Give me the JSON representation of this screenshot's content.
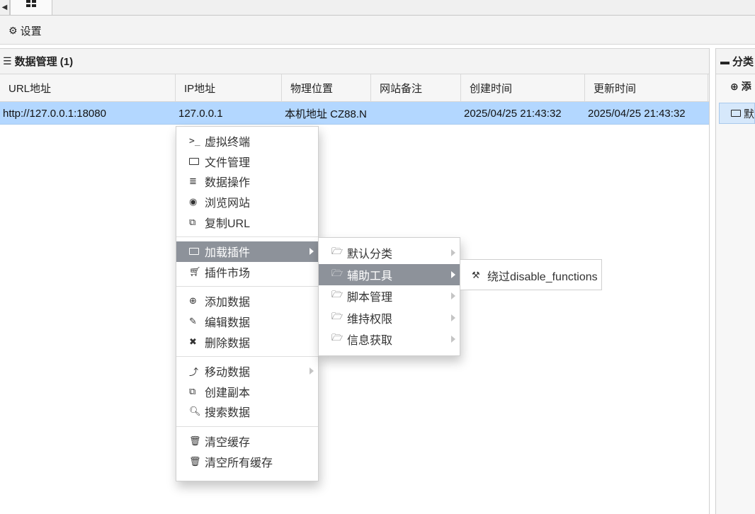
{
  "toolbar": {
    "settings_label": "设置"
  },
  "data_panel": {
    "title": "数据管理 (1)",
    "columns": [
      "URL地址",
      "IP地址",
      "物理位置",
      "网站备注",
      "创建时间",
      "更新时间"
    ],
    "rows": [
      {
        "url": "http://127.0.0.1:18080",
        "ip": "127.0.0.1",
        "location": "本机地址 CZ88.N",
        "note": "",
        "created": "2025/04/25 21:43:32",
        "updated": "2025/04/25 21:43:32"
      }
    ]
  },
  "category_panel": {
    "title": "分类",
    "add_label": "添",
    "selected_item": "默"
  },
  "context_menu": {
    "groups": [
      [
        {
          "label": "虚拟终端",
          "icon": "terminal-icon"
        },
        {
          "label": "文件管理",
          "icon": "folder-icon"
        },
        {
          "label": "数据操作",
          "icon": "database-icon"
        },
        {
          "label": "浏览网站",
          "icon": "chrome-icon"
        },
        {
          "label": "复制URL",
          "icon": "copy-icon"
        }
      ],
      [
        {
          "label": "加载插件",
          "icon": "folder-icon",
          "submenu": true,
          "active": true
        },
        {
          "label": "插件市场",
          "icon": "cart-icon"
        }
      ],
      [
        {
          "label": "添加数据",
          "icon": "plus-circle-icon"
        },
        {
          "label": "编辑数据",
          "icon": "edit-icon"
        },
        {
          "label": "删除数据",
          "icon": "close-icon"
        }
      ],
      [
        {
          "label": "移动数据",
          "icon": "share-icon",
          "submenu": true
        },
        {
          "label": "创建副本",
          "icon": "copy-icon"
        },
        {
          "label": "搜索数据",
          "icon": "search-icon"
        }
      ],
      [
        {
          "label": "清空缓存",
          "icon": "trash-outline-icon"
        },
        {
          "label": "清空所有缓存",
          "icon": "trash-icon"
        }
      ]
    ]
  },
  "plugin_submenu": {
    "items": [
      {
        "label": "默认分类",
        "icon": "folder-open-icon"
      },
      {
        "label": "辅助工具",
        "icon": "folder-open-icon",
        "active": true
      },
      {
        "label": "脚本管理",
        "icon": "folder-open-icon"
      },
      {
        "label": "维持权限",
        "icon": "folder-open-icon"
      },
      {
        "label": "信息获取",
        "icon": "folder-open-icon"
      }
    ]
  },
  "tool_submenu": {
    "items": [
      {
        "label": "绕过disable_functions",
        "icon": "gavel-icon"
      }
    ]
  },
  "colors": {
    "row_selected": "#b3d7ff",
    "menu_active": "#8d929a"
  }
}
